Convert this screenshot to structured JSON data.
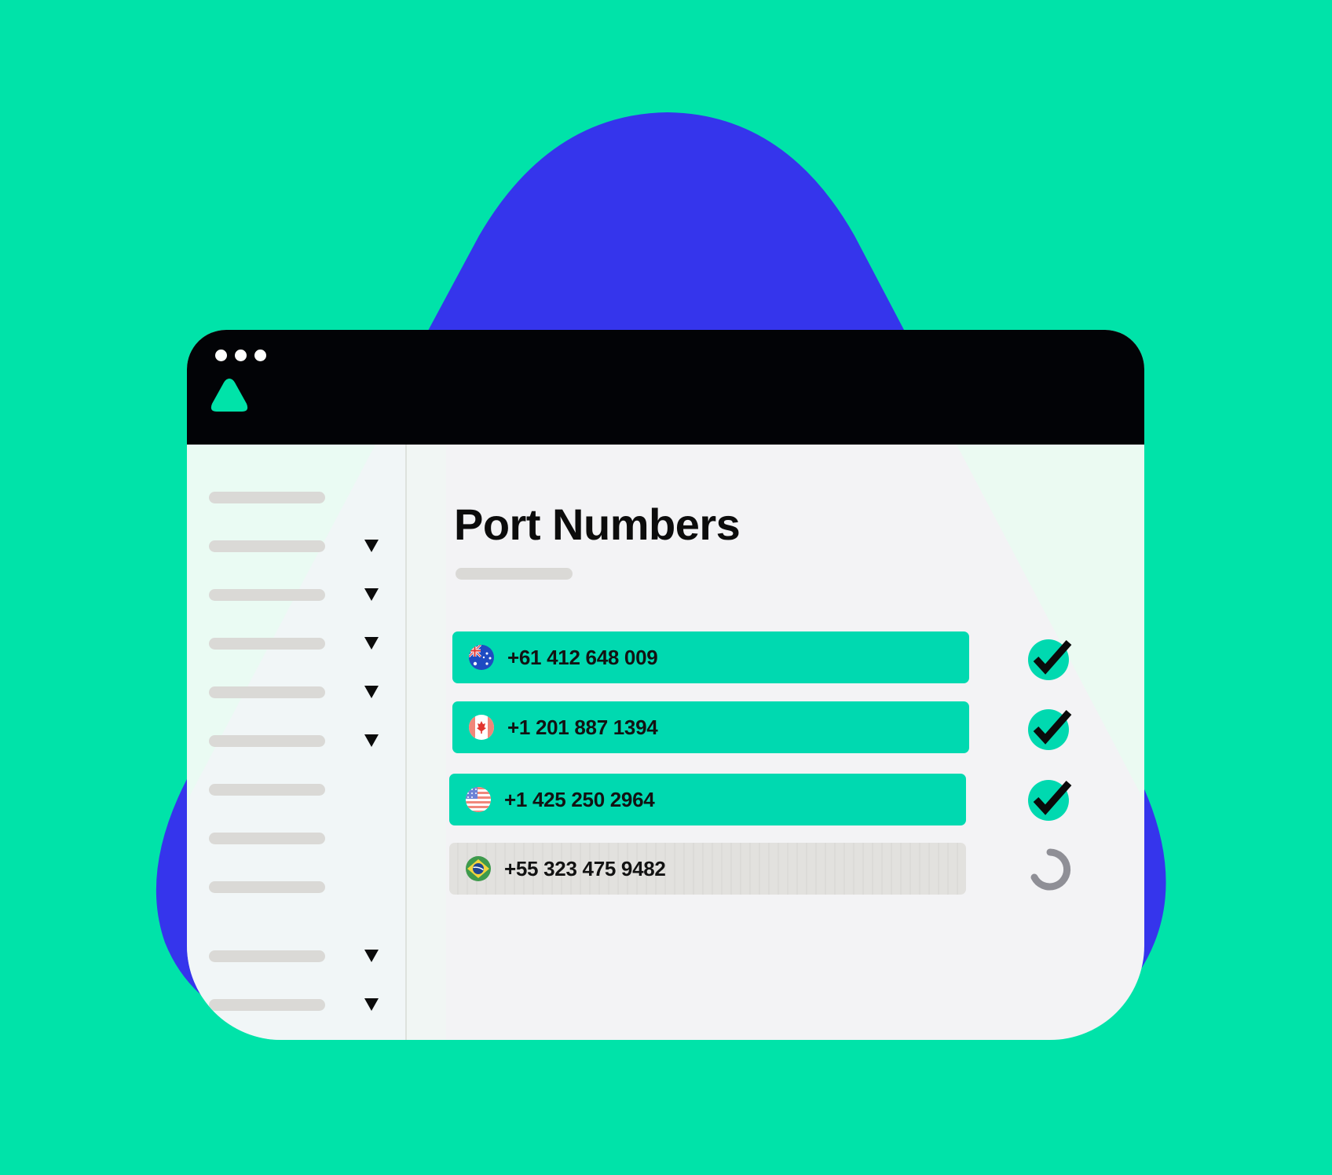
{
  "window": {
    "title": "Port Numbers"
  },
  "sidebar": {
    "items": [
      {
        "has_caret": false
      },
      {
        "has_caret": true
      },
      {
        "has_caret": true
      },
      {
        "has_caret": true
      },
      {
        "has_caret": true
      },
      {
        "has_caret": true
      },
      {
        "has_caret": false
      },
      {
        "has_caret": false
      },
      {
        "has_caret": false
      }
    ],
    "footer_items": [
      {
        "has_caret": true
      },
      {
        "has_caret": true
      }
    ]
  },
  "ports": [
    {
      "number": "+61 412 648 009",
      "flag_icon": "australia-flag-icon",
      "status": "done",
      "status_icon": "check-icon"
    },
    {
      "number": "+1 201 887 1394",
      "flag_icon": "canada-flag-icon",
      "status": "done",
      "status_icon": "check-icon"
    },
    {
      "number": "+1 425 250 2964",
      "flag_icon": "usa-flag-icon",
      "status": "done",
      "status_icon": "check-icon"
    },
    {
      "number": "+55 323 475 9482",
      "flag_icon": "brazil-flag-icon",
      "status": "pending",
      "status_icon": "loading-spinner-icon"
    }
  ],
  "colors": {
    "background": "#00E3A9",
    "blob": "#3535EC",
    "title_bar": "#020306",
    "accent": "#00D9B0",
    "pending_row": "#E2E1DE",
    "placeholder_bar": "#DAD9D6"
  }
}
